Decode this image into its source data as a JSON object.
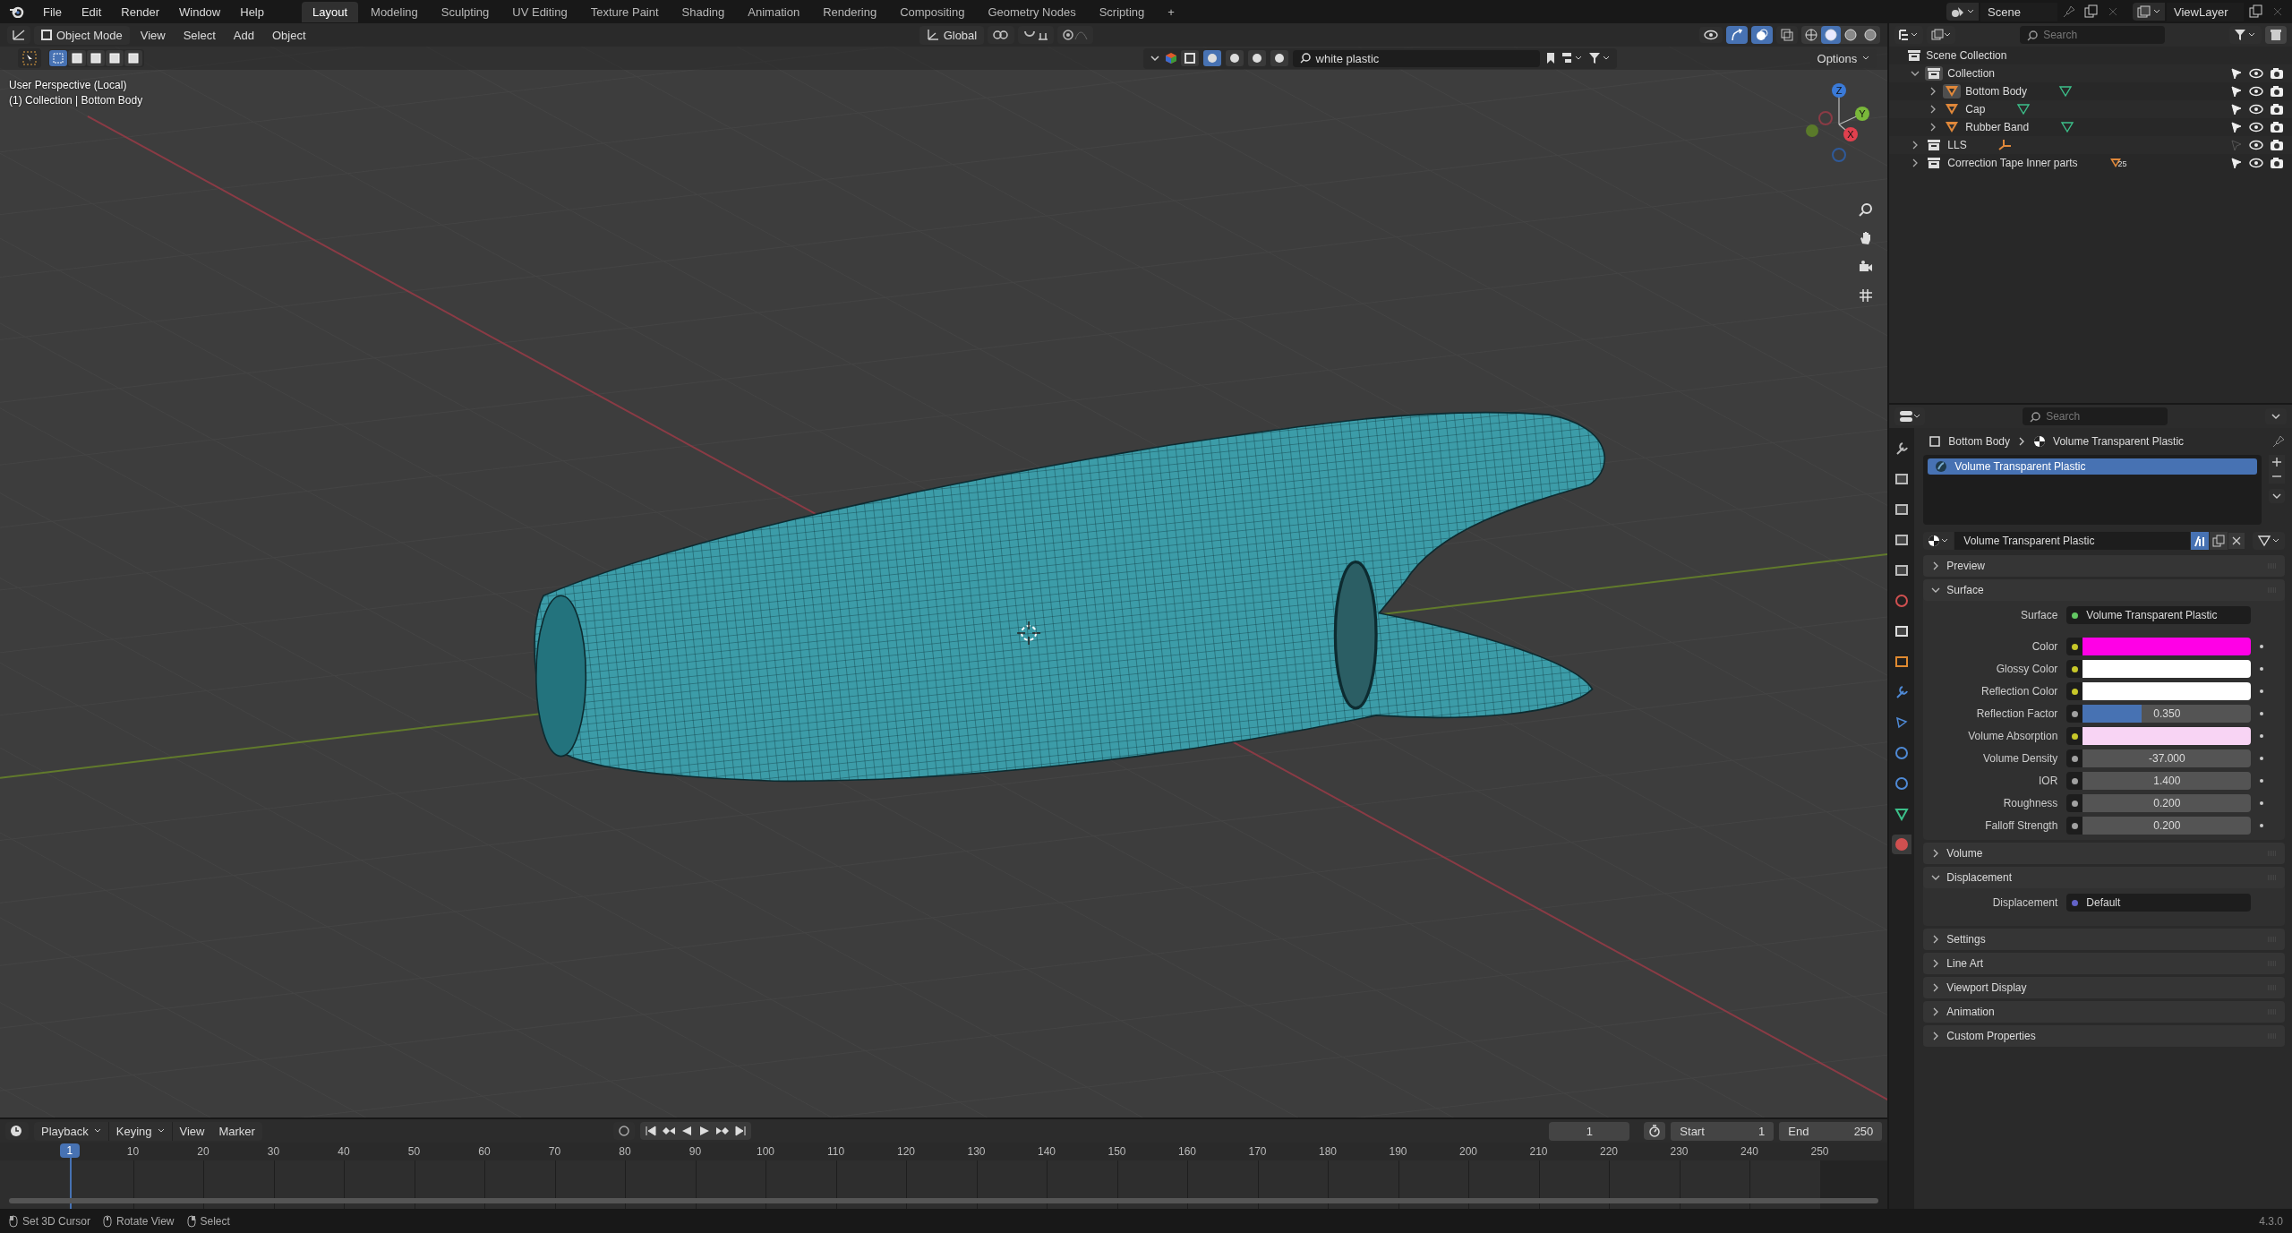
{
  "topbar": {
    "menus": [
      "File",
      "Edit",
      "Render",
      "Window",
      "Help"
    ],
    "workspaces": [
      {
        "label": "Layout",
        "selected": true
      },
      {
        "label": "Modeling",
        "selected": false
      },
      {
        "label": "Sculpting",
        "selected": false
      },
      {
        "label": "UV Editing",
        "selected": false
      },
      {
        "label": "Texture Paint",
        "selected": false
      },
      {
        "label": "Shading",
        "selected": false
      },
      {
        "label": "Animation",
        "selected": false
      },
      {
        "label": "Rendering",
        "selected": false
      },
      {
        "label": "Compositing",
        "selected": false
      },
      {
        "label": "Geometry Nodes",
        "selected": false
      },
      {
        "label": "Scripting",
        "selected": false
      }
    ],
    "add_tab": "+",
    "scene": "Scene",
    "view_layer": "ViewLayer"
  },
  "viewport": {
    "mode": "Object Mode",
    "menus": [
      "View",
      "Select",
      "Add",
      "Object"
    ],
    "transform": "Global",
    "filter_search": "white plastic",
    "options": "Options",
    "select_modes": [
      {
        "selected": true
      },
      {
        "selected": false
      },
      {
        "selected": false
      },
      {
        "selected": false
      },
      {
        "selected": false
      }
    ],
    "shading": [
      {
        "selected": false
      },
      {
        "selected": true
      },
      {
        "selected": false
      },
      {
        "selected": false
      }
    ],
    "overlay_lines": [
      "User Perspective (Local)",
      "(1) Collection | Bottom Body"
    ],
    "gizmo_axes": [
      "X",
      "Y",
      "Z"
    ]
  },
  "outliner": {
    "search_placeholder": "Search",
    "root": "Scene Collection",
    "items": [
      {
        "name": "Collection",
        "kind": "collection",
        "expanded": true,
        "active": true,
        "selectable": true,
        "children": [
          {
            "name": "Bottom Body",
            "kind": "mesh",
            "expanded": false,
            "active": true,
            "selectable": true,
            "data": {
              "kind": "mesh"
            }
          },
          {
            "name": "Cap",
            "kind": "mesh",
            "expanded": false,
            "active": false,
            "selectable": true,
            "data": {
              "kind": "mesh"
            }
          },
          {
            "name": "Rubber Band",
            "kind": "mesh",
            "expanded": false,
            "active": false,
            "selectable": true,
            "data": {
              "kind": "mesh"
            }
          }
        ]
      },
      {
        "name": "LLS",
        "kind": "collection",
        "expanded": false,
        "active": false,
        "selectable": false,
        "data": {
          "kind": "empty"
        }
      },
      {
        "name": "Correction Tape Inner parts",
        "kind": "collection",
        "expanded": false,
        "active": false,
        "selectable": true,
        "data": {
          "kind": "objects",
          "count": "25"
        }
      }
    ]
  },
  "properties": {
    "search_placeholder": "Search",
    "tabs": [
      {
        "kind": "tool",
        "selected": false
      },
      {
        "kind": "render",
        "selected": false
      },
      {
        "kind": "output",
        "selected": false
      },
      {
        "kind": "view_layer",
        "selected": false
      },
      {
        "kind": "scene",
        "selected": false
      },
      {
        "kind": "world",
        "selected": false
      },
      {
        "kind": "collection",
        "selected": false
      },
      {
        "kind": "object",
        "selected": false
      },
      {
        "kind": "modifiers",
        "selected": false
      },
      {
        "kind": "particles",
        "selected": false
      },
      {
        "kind": "physics",
        "selected": false
      },
      {
        "kind": "constraints",
        "selected": false
      },
      {
        "kind": "data",
        "selected": false
      },
      {
        "kind": "material",
        "selected": true
      }
    ],
    "breadcrumb": [
      "Bottom Body",
      "Volume Transparent Plastic"
    ],
    "slots": [
      {
        "name": "Volume Transparent Plastic",
        "selected": true
      }
    ],
    "material": "Volume Transparent Plastic",
    "panels": [
      {
        "title": "Preview",
        "expanded": false
      },
      {
        "title": "Surface",
        "expanded": true,
        "fields": [
          {
            "label": "Surface",
            "kind": "link",
            "socket": {
              "color": "#63c763"
            },
            "value": "Volume Transparent Plastic"
          },
          {
            "label": "Color",
            "kind": "color",
            "socket": {
              "color": "#c7c729"
            },
            "color": "#ff00e6"
          },
          {
            "label": "Glossy Color",
            "kind": "color",
            "socket": {
              "color": "#c7c729"
            },
            "color": "#ffffff"
          },
          {
            "label": "Reflection Color",
            "kind": "color",
            "socket": {
              "color": "#c7c729"
            },
            "color": "#ffffff"
          },
          {
            "label": "Reflection Factor",
            "kind": "slider",
            "socket": {
              "color": "#a1a1a1"
            },
            "value": "0.350",
            "level": 0.35
          },
          {
            "label": "Volume Absorption",
            "kind": "color",
            "socket": {
              "color": "#c7c729"
            },
            "color": "#f8d4f4"
          },
          {
            "label": "Volume Density",
            "kind": "number",
            "socket": {
              "color": "#a1a1a1"
            },
            "value": "-37.000"
          },
          {
            "label": "IOR",
            "kind": "number",
            "socket": {
              "color": "#a1a1a1"
            },
            "value": "1.400"
          },
          {
            "label": "Roughness",
            "kind": "number",
            "socket": {
              "color": "#a1a1a1"
            },
            "value": "0.200"
          },
          {
            "label": "Falloff Strength",
            "kind": "number",
            "socket": {
              "color": "#a1a1a1"
            },
            "value": "0.200"
          }
        ]
      },
      {
        "title": "Volume",
        "expanded": false
      },
      {
        "title": "Displacement",
        "expanded": true,
        "fields": [
          {
            "label": "Displacement",
            "kind": "link",
            "socket": {
              "color": "#6363c7"
            },
            "value": "Default"
          }
        ]
      },
      {
        "title": "Settings",
        "expanded": false
      },
      {
        "title": "Line Art",
        "expanded": false
      },
      {
        "title": "Viewport Display",
        "expanded": false
      },
      {
        "title": "Animation",
        "expanded": false
      },
      {
        "title": "Custom Properties",
        "expanded": false
      }
    ]
  },
  "timeline": {
    "menus": [
      "Playback",
      "Keying",
      "View",
      "Marker"
    ],
    "current_frame": "1",
    "start_label": "Start",
    "start": "1",
    "end_label": "End",
    "end": "250",
    "playhead": "1",
    "ticks": [
      "10",
      "20",
      "30",
      "40",
      "50",
      "60",
      "70",
      "80",
      "90",
      "100",
      "110",
      "120",
      "130",
      "140",
      "150",
      "160",
      "170",
      "180",
      "190",
      "200",
      "210",
      "220",
      "230",
      "240",
      "250"
    ]
  },
  "status_bar": {
    "hints": [
      "Set 3D Cursor",
      "Rotate View",
      "Select"
    ],
    "version": "4.3.0"
  }
}
